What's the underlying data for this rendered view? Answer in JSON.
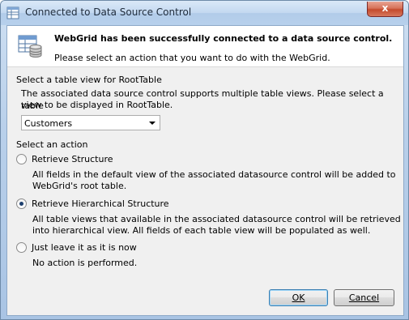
{
  "window": {
    "title": "Connected to Data Source Control"
  },
  "titlebar": {
    "close_glyph": "x"
  },
  "banner": {
    "icon": "database-table-icon",
    "title": "WebGrid has been successfully connected to a data source control.",
    "subtitle": "Please select an action that you want to do with the WebGrid."
  },
  "table_view": {
    "heading": "Select a table view for RootTable",
    "description_line1": "The associated data source control supports multiple table views. Please select a table",
    "description_line2": "view to be displayed in RootTable.",
    "selected": "Customers"
  },
  "actions": {
    "heading": "Select an action",
    "options": [
      {
        "label": "Retrieve Structure",
        "selected": false,
        "desc_line1": "All fields in the default view of the associated datasource control will be added to",
        "desc_line2": "WebGrid's root table."
      },
      {
        "label": "Retrieve Hierarchical Structure",
        "selected": true,
        "desc_line1": "All table views that available in the associated datasource control will be retrieved",
        "desc_line2": "into hierarchical view. All fields of each table view will be populated as well."
      },
      {
        "label": "Just leave it as it is now",
        "selected": false,
        "desc_line1": "No action is performed."
      }
    ]
  },
  "buttons": {
    "ok_label": "OK",
    "cancel_label": "Cancel"
  }
}
